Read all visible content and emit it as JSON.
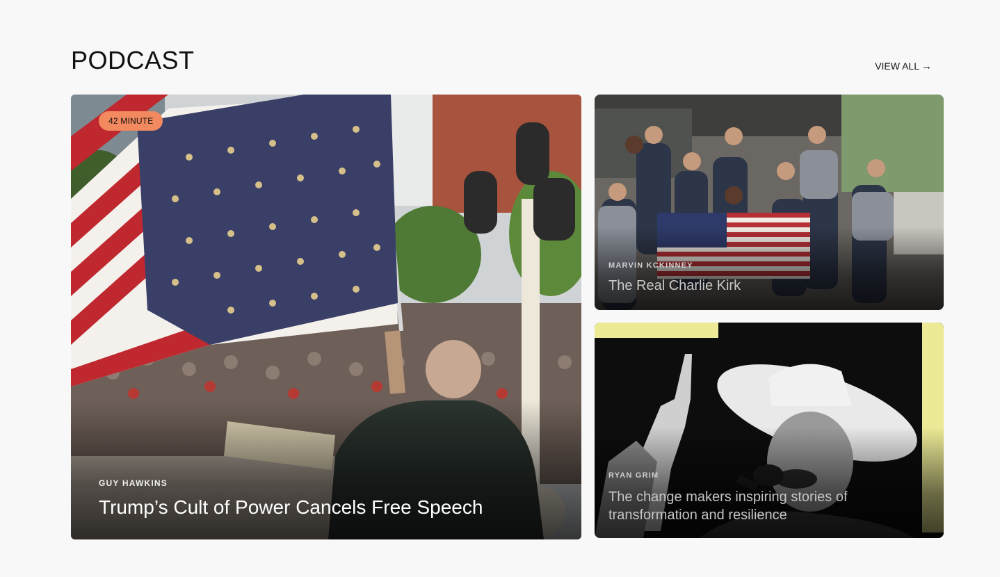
{
  "section": {
    "title": "PODCAST",
    "view_all_label": "VIEW ALL",
    "view_all_icon": "arrow-right-icon"
  },
  "cards": [
    {
      "badge": "42 MINUTE",
      "author": "GUY HAWKINS",
      "title": "Trump’s Cult of Power Cancels Free Speech"
    },
    {
      "author": "MARVIN KCKINNEY",
      "title": "The Real Charlie Kirk"
    },
    {
      "author": "RYAN GRIM",
      "title": "The change makers inspiring stories of transformation and resilience"
    }
  ],
  "colors": {
    "background": "#f8f8f8",
    "badge": "#f2895f",
    "accent_yellow": "#ecea96"
  }
}
